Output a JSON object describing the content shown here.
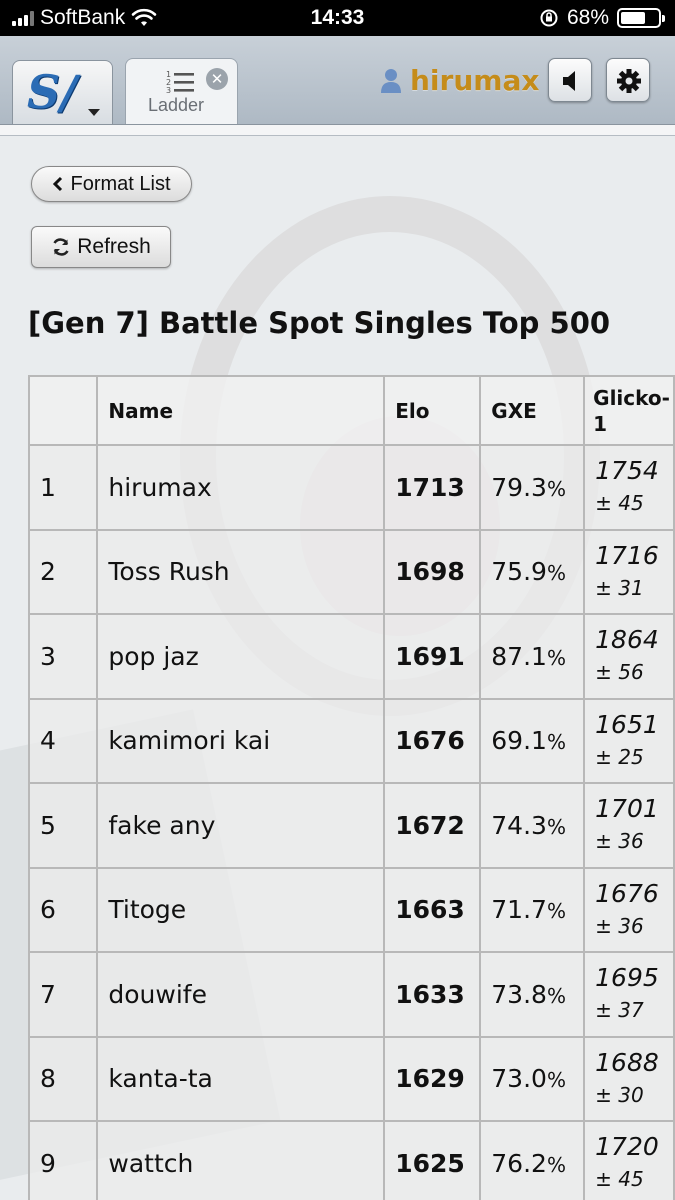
{
  "status_bar": {
    "carrier": "SoftBank",
    "time": "14:33",
    "battery": "68%",
    "battery_level": 0.68
  },
  "header": {
    "tab_label": "Ladder",
    "tab_list_digits": [
      "1",
      "2",
      "3"
    ],
    "username": "hirumax",
    "colors": {
      "username": "#c58c1a",
      "logo": "#2b6cb5"
    }
  },
  "page": {
    "format_list_label": "Format List",
    "refresh_label": "Refresh",
    "title": "[Gen 7] Battle Spot Singles Top 500"
  },
  "table": {
    "headers": {
      "rank": "",
      "name": "Name",
      "elo": "Elo",
      "gxe": "GXE",
      "glicko": "Glicko-1"
    },
    "rows": [
      {
        "rank": "1",
        "name": "hirumax",
        "elo": "1713",
        "gxe": "79.3",
        "gxe_unit": "%",
        "glicko": "1754",
        "dev": "± 45"
      },
      {
        "rank": "2",
        "name": "Toss Rush",
        "elo": "1698",
        "gxe": "75.9",
        "gxe_unit": "%",
        "glicko": "1716",
        "dev": "± 31"
      },
      {
        "rank": "3",
        "name": "pop jaz",
        "elo": "1691",
        "gxe": "87.1",
        "gxe_unit": "%",
        "glicko": "1864",
        "dev": "± 56"
      },
      {
        "rank": "4",
        "name": "kamimori kai",
        "elo": "1676",
        "gxe": "69.1",
        "gxe_unit": "%",
        "glicko": "1651",
        "dev": "± 25"
      },
      {
        "rank": "5",
        "name": "fake any",
        "elo": "1672",
        "gxe": "74.3",
        "gxe_unit": "%",
        "glicko": "1701",
        "dev": "± 36"
      },
      {
        "rank": "6",
        "name": "Titoge",
        "elo": "1663",
        "gxe": "71.7",
        "gxe_unit": "%",
        "glicko": "1676",
        "dev": "± 36"
      },
      {
        "rank": "7",
        "name": "douwife",
        "elo": "1633",
        "gxe": "73.8",
        "gxe_unit": "%",
        "glicko": "1695",
        "dev": "± 37"
      },
      {
        "rank": "8",
        "name": "kanta-ta",
        "elo": "1629",
        "gxe": "73.0",
        "gxe_unit": "%",
        "glicko": "1688",
        "dev": "± 30"
      },
      {
        "rank": "9",
        "name": "wattch",
        "elo": "1625",
        "gxe": "76.2",
        "gxe_unit": "%",
        "glicko": "1720",
        "dev": "± 45"
      }
    ]
  }
}
